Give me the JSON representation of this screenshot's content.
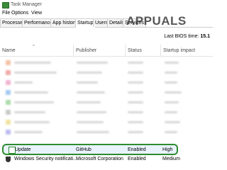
{
  "window": {
    "title": "Task Manager"
  },
  "menu": {
    "items": [
      "File",
      "Options",
      "View"
    ]
  },
  "tabs": [
    "Processes",
    "Performance",
    "App history",
    "Startup",
    "Users",
    "Details",
    "Services"
  ],
  "active_tab": "Startup",
  "watermark": "APPUALS",
  "bios": {
    "label": "Last BIOS time:",
    "value": "15.1"
  },
  "columns": [
    "Name",
    "Publisher",
    "Status",
    "Startup impact"
  ],
  "rows": [
    {
      "name": "Update",
      "publisher": "GitHub",
      "status": "Enabled",
      "impact": "High"
    },
    {
      "name": "Windows Security notificati...",
      "publisher": "Microsoft Corporation",
      "status": "Enabled",
      "impact": "Medium"
    }
  ],
  "colors": {
    "highlight_border": "#2e8b2e",
    "highlight_fill": "#e9f3ff"
  }
}
